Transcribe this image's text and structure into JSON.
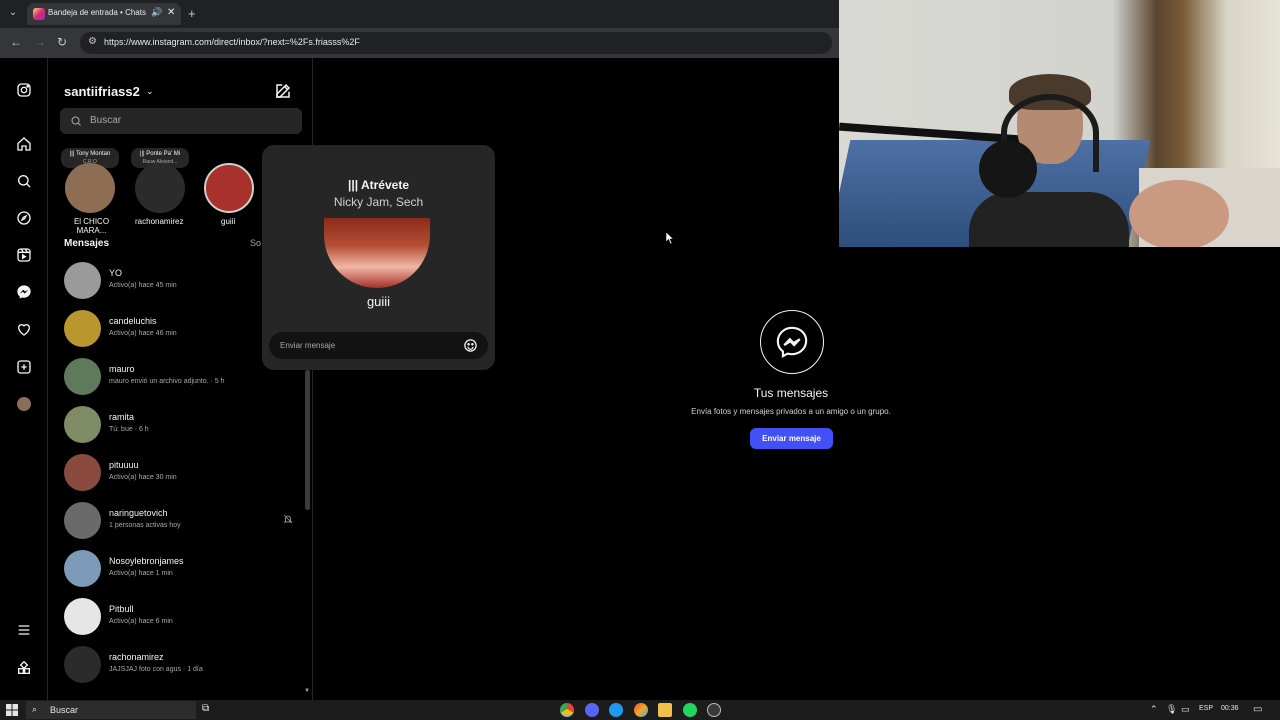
{
  "browser": {
    "tab_title": "Bandeja de entrada • Chats",
    "url": "https://www.instagram.com/direct/inbox/?next=%2Fs.friasss%2F"
  },
  "inbox": {
    "account_name": "santiifriass2",
    "search_placeholder": "Buscar",
    "notes": [
      {
        "note": "Tony Montan",
        "note_sub": "C.R.O",
        "name": "El CHICO MARA...",
        "avatar_color": "#8d6e54"
      },
      {
        "note": "Ponte Pa' Mi",
        "note_sub": "Rauw Alejand...",
        "name": "rachonamirez",
        "avatar_color": "#2b2b2b"
      },
      {
        "note": "",
        "note_sub": "",
        "name": "guiii",
        "avatar_color": "#a8322b"
      }
    ],
    "section_label": "Mensajes",
    "section_side": "So",
    "conversations": [
      {
        "name": "YO",
        "status": "Activo(a) hace 45 min",
        "avatar_color": "#9a9a9a"
      },
      {
        "name": "candeluchis",
        "status": "Activo(a) hace 46 min",
        "avatar_color": "#b9962e"
      },
      {
        "name": "mauro",
        "status": "mauro envió un archivo adjunto. · 5 h",
        "avatar_color": "#5f7a5a"
      },
      {
        "name": "ramita",
        "status": "Tú: bue · 6 h",
        "avatar_color": "#7f8b64"
      },
      {
        "name": "pituuuu",
        "status": "Activo(a) hace 30 min",
        "avatar_color": "#8a4a3f"
      },
      {
        "name": "naringuetovich",
        "status": "1 personas activas hoy",
        "avatar_color": "#6a6a6a"
      },
      {
        "name": "Nosoylebronjames",
        "status": "Activo(a) hace 1 min",
        "avatar_color": "#7d9bb8"
      },
      {
        "name": "Pitbull",
        "status": "Activo(a) hace 6 min",
        "avatar_color": "#e6e6e6"
      },
      {
        "name": "rachonamirez",
        "status": "JAJSJAJ foto con agus · 1 día",
        "avatar_color": "#2b2b2b"
      }
    ]
  },
  "note_popover": {
    "song_title": "Atrévete",
    "song_artist": "Nicky Jam, Sech",
    "user_name": "guiii",
    "message_placeholder": "Enviar mensaje"
  },
  "empty_state": {
    "title": "Tus mensajes",
    "text": "Envía fotos y mensajes privados a un amigo o un grupo.",
    "button": "Enviar mensaje"
  },
  "taskbar": {
    "search_text": "Buscar",
    "language": "ESP",
    "time": "00:36"
  },
  "colors": {
    "accent_blue": "#4150f7",
    "background": "#000000",
    "panel": "#262626"
  }
}
